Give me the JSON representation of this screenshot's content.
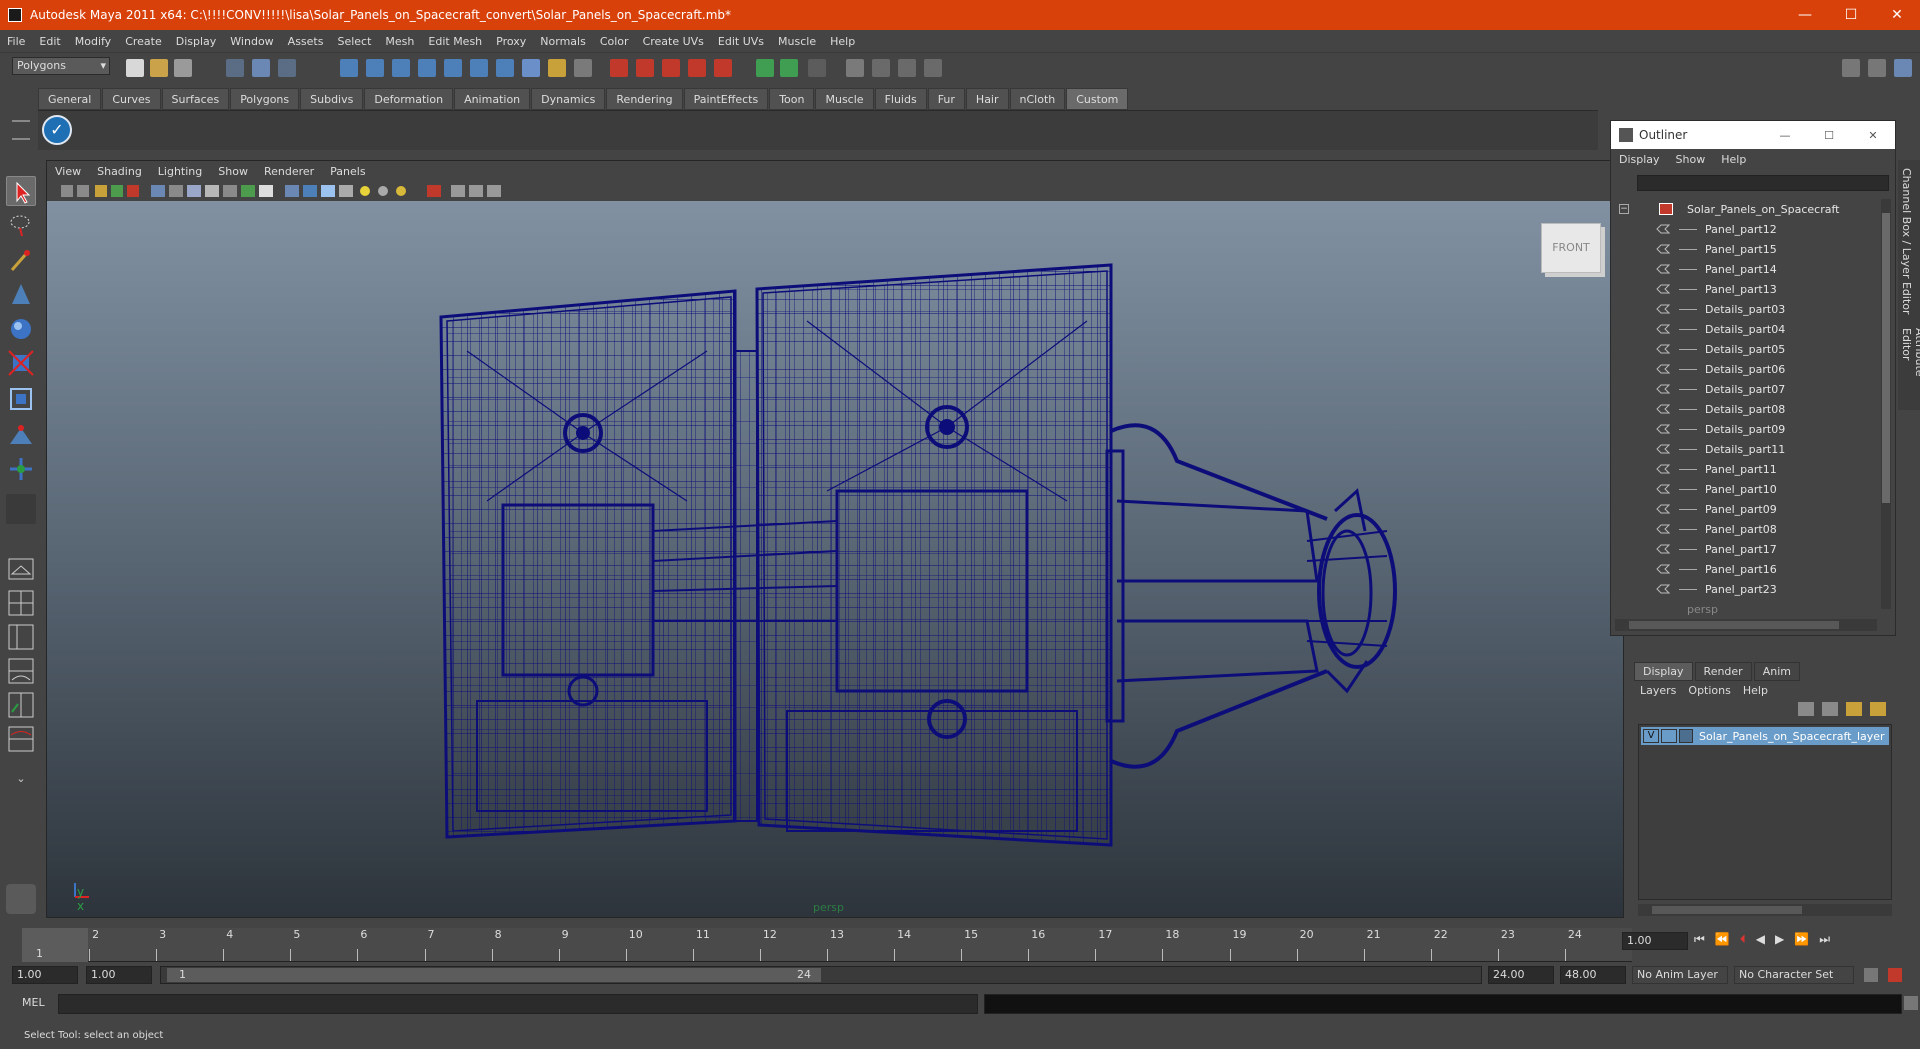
{
  "window": {
    "title": "Autodesk Maya 2011 x64: C:\\!!!!CONV!!!!!\\lisa\\Solar_Panels_on_Spacecraft_convert\\Solar_Panels_on_Spacecraft.mb*",
    "minimize": "—",
    "maximize": "☐",
    "close": "✕"
  },
  "menubar": [
    "File",
    "Edit",
    "Modify",
    "Create",
    "Display",
    "Window",
    "Assets",
    "Select",
    "Mesh",
    "Edit Mesh",
    "Proxy",
    "Normals",
    "Color",
    "Create UVs",
    "Edit UVs",
    "Muscle",
    "Help"
  ],
  "mode_selector": "Polygons",
  "shelf_tabs": [
    "General",
    "Curves",
    "Surfaces",
    "Polygons",
    "Subdivs",
    "Deformation",
    "Animation",
    "Dynamics",
    "Rendering",
    "PaintEffects",
    "Toon",
    "Muscle",
    "Fluids",
    "Fur",
    "Hair",
    "nCloth",
    "Custom"
  ],
  "active_shelf_tab": "Custom",
  "viewport": {
    "menu": [
      "View",
      "Shading",
      "Lighting",
      "Show",
      "Renderer",
      "Panels"
    ],
    "camera_label": "persp",
    "viewcube_label": "FRONT",
    "axis_label": "y x"
  },
  "outliner": {
    "title": "Outliner",
    "menu": [
      "Display",
      "Show",
      "Help"
    ],
    "root": "Solar_Panels_on_Spacecraft",
    "items": [
      "Panel_part12",
      "Panel_part15",
      "Panel_part14",
      "Panel_part13",
      "Details_part03",
      "Details_part04",
      "Details_part05",
      "Details_part06",
      "Details_part07",
      "Details_part08",
      "Details_part09",
      "Details_part11",
      "Panel_part11",
      "Panel_part10",
      "Panel_part09",
      "Panel_part08",
      "Panel_part17",
      "Panel_part16",
      "Panel_part23"
    ],
    "trailing_item": "persp"
  },
  "side_tabs": [
    "Channel Box / Layer Editor",
    "Attribute Editor"
  ],
  "layer_editor": {
    "tabs": [
      "Display",
      "Render",
      "Anim"
    ],
    "active_tab": "Display",
    "menu": [
      "Layers",
      "Options",
      "Help"
    ],
    "layer_visibility": "V",
    "layer_name": "Solar_Panels_on_Spacecraft_layer"
  },
  "timeline": {
    "ticks": [
      "1",
      "2",
      "3",
      "4",
      "5",
      "6",
      "7",
      "8",
      "9",
      "10",
      "11",
      "12",
      "13",
      "14",
      "15",
      "16",
      "17",
      "18",
      "19",
      "20",
      "21",
      "22",
      "23",
      "24"
    ],
    "current_frame": "1",
    "current_time_field": "1.00"
  },
  "range": {
    "start_time": "1.00",
    "playback_start": "1.00",
    "range_start_label": "1",
    "range_end_label": "24",
    "playback_end": "24.00",
    "end_time": "48.00",
    "anim_layer": "No Anim Layer",
    "character_set": "No Character Set"
  },
  "command_line": {
    "label": "MEL"
  },
  "help_line": "Select Tool: select an object",
  "colors": {
    "titlebar": "#d9410b",
    "wireframe": "#0d0d7a",
    "selected_layer": "#6a9cc9"
  }
}
